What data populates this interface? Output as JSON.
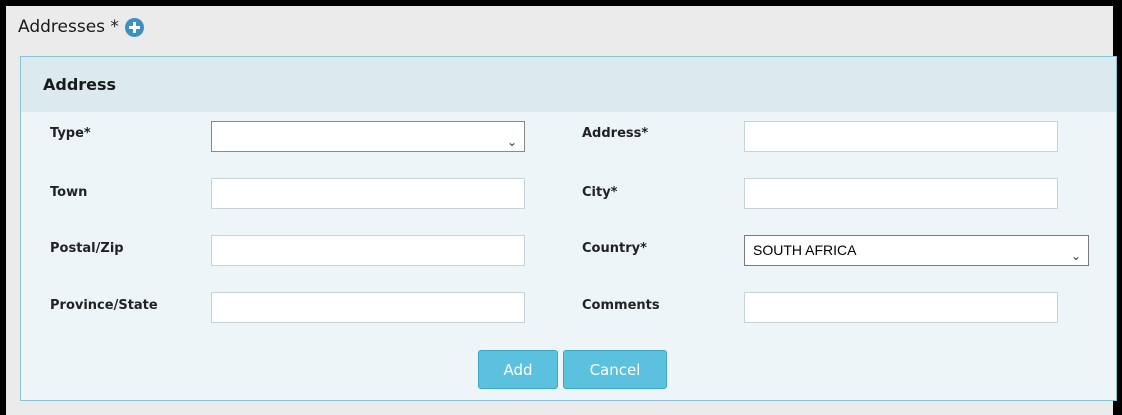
{
  "section": {
    "title": "Addresses *",
    "add_icon": "plus-circle-icon"
  },
  "panel": {
    "title": "Address"
  },
  "fields": {
    "type": {
      "label": "Type*",
      "value": ""
    },
    "address": {
      "label": "Address*",
      "value": ""
    },
    "town": {
      "label": "Town",
      "value": ""
    },
    "city": {
      "label": "City*",
      "value": ""
    },
    "postal": {
      "label": "Postal/Zip",
      "value": ""
    },
    "country": {
      "label": "Country*",
      "value": "SOUTH AFRICA"
    },
    "province": {
      "label": "Province/State",
      "value": ""
    },
    "comments": {
      "label": "Comments",
      "value": ""
    }
  },
  "buttons": {
    "add": "Add",
    "cancel": "Cancel"
  },
  "colors": {
    "panel_border": "#89c4d6",
    "panel_header": "#dbeaef",
    "button": "#5bc1de",
    "plus_icon": "#3e8fc2"
  }
}
